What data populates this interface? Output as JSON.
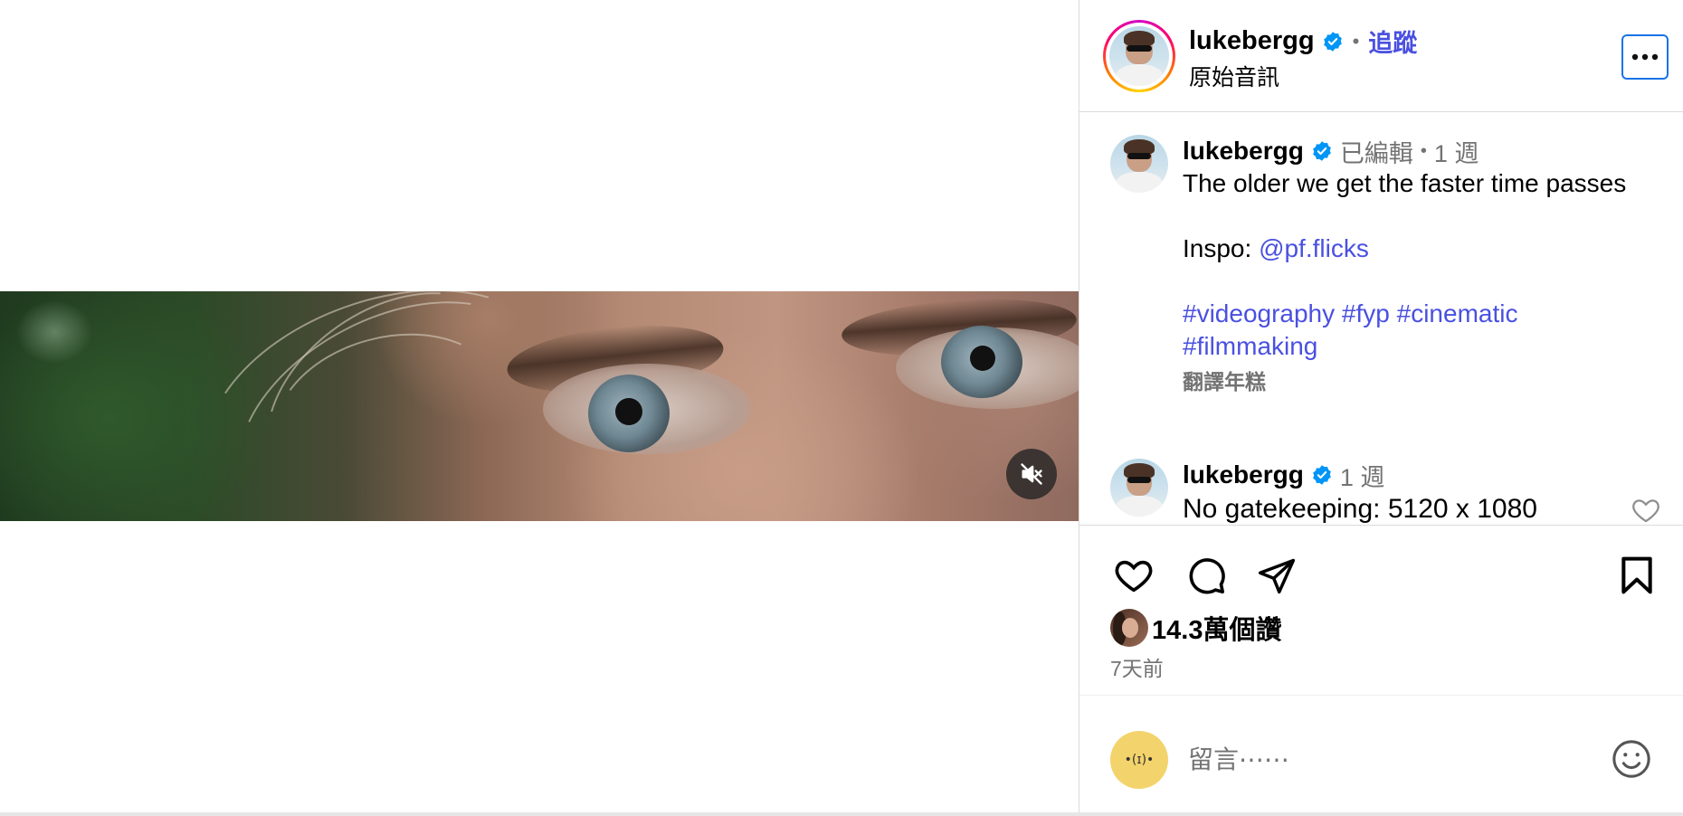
{
  "post": {
    "author": "lukebergg",
    "follow_label": "追蹤",
    "audio_label": "原始音訊",
    "video_mute_icon": "speaker-muted-icon"
  },
  "caption": {
    "author": "lukebergg",
    "edited": "已編輯",
    "age": "1 週",
    "line1": "The older we get the faster time passes",
    "inspo_prefix": "Inspo: ",
    "inspo_mention": "@pf.flicks",
    "hashtags": [
      "#videography",
      "#fyp",
      "#cinematic",
      "#filmmaking"
    ],
    "translate_label": "翻譯年糕"
  },
  "comment": {
    "author": "lukebergg",
    "age": "1 週",
    "text": "No gatekeeping: 5120 x 1080"
  },
  "likes": {
    "count_label": "14.3萬個讚"
  },
  "timestamp": "7天前",
  "composer": {
    "placeholder": "留言⋯⋯",
    "avatar_text": "•(ɪ)•"
  },
  "colors": {
    "link": "#4a50e0",
    "verified": "#0095f6",
    "muted_text": "#737373",
    "more_button_border": "#1a73e8"
  },
  "icons": [
    "verified-badge-icon",
    "more-options-icon",
    "heart-icon",
    "comment-icon",
    "share-icon",
    "bookmark-icon",
    "emoji-icon",
    "speaker-muted-icon"
  ]
}
